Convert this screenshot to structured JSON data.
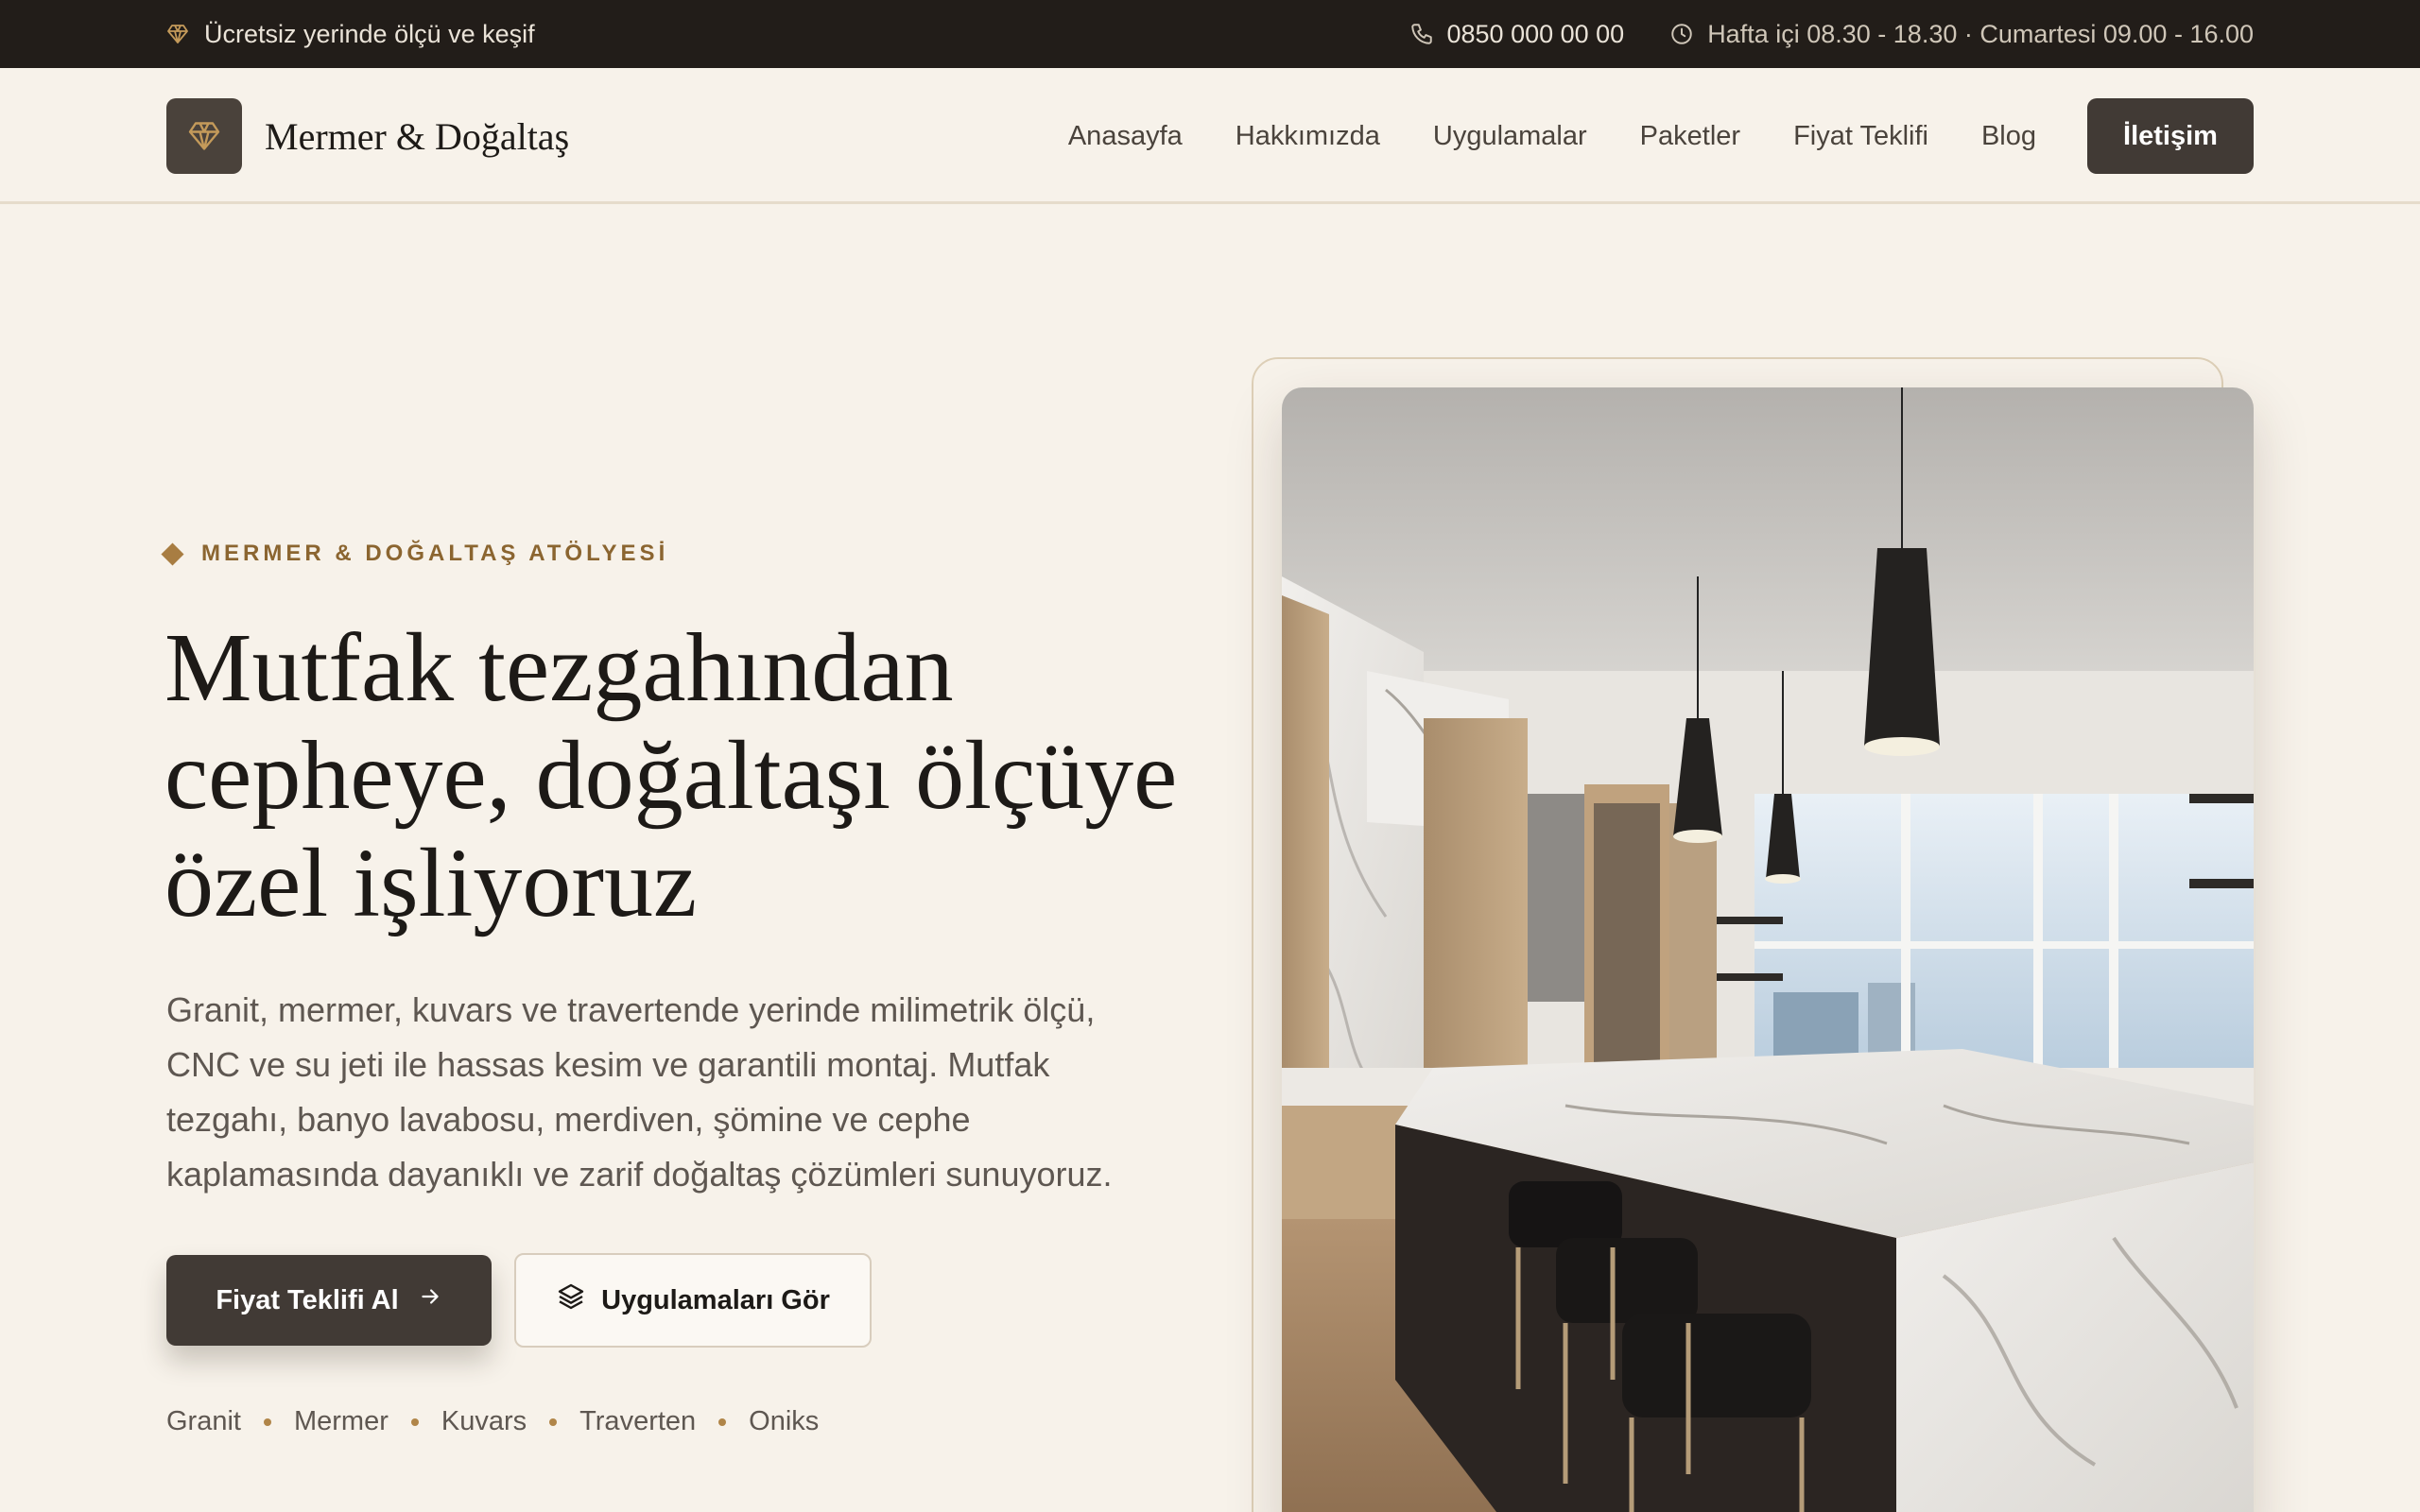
{
  "topbar": {
    "promo_icon": "diamond-icon",
    "promo_text": "Ücretsiz yerinde ölçü ve keşif",
    "phone_icon": "phone-icon",
    "phone": "0850 000 00 00",
    "hours_icon": "clock-icon",
    "hours": "Hafta içi 08.30 - 18.30 · Cumartesi 09.00 - 16.00"
  },
  "nav": {
    "brand_icon": "diamond-icon",
    "brand_name": "Mermer & Doğaltaş",
    "items": [
      {
        "label": "Anasayfa"
      },
      {
        "label": "Hakkımızda"
      },
      {
        "label": "Uygulamalar"
      },
      {
        "label": "Paketler"
      },
      {
        "label": "Fiyat Teklifi"
      },
      {
        "label": "Blog"
      }
    ],
    "cta": "İletişim"
  },
  "hero": {
    "eyebrow": "MERMER & DOĞALTAŞ ATÖLYESİ",
    "headline": "Mutfak tezgahından cepheye, doğaltaşı ölçüye özel işliyoruz",
    "lead": "Granit, mermer, kuvars ve travertende yerinde milimetrik ölçü, CNC ve su jeti ile hassas kesim ve garantili montaj. Mutfak tezgahı, banyo lavabosu, merdiven, şömine ve cephe kaplamasında dayanıklı ve zarif doğaltaş çözümleri sunuyoruz.",
    "primary_button": "Fiyat Teklifi Al",
    "primary_icon": "arrow-right-icon",
    "secondary_button": "Uygulamaları Gör",
    "secondary_icon": "layers-icon",
    "tags": [
      "Granit",
      "Mermer",
      "Kuvars",
      "Traverten",
      "Oniks"
    ]
  },
  "colors": {
    "topbar_bg": "#221d19",
    "page_bg": "#f7f2ea",
    "button_dark": "#413a35",
    "accent_gold": "#a87d42"
  }
}
